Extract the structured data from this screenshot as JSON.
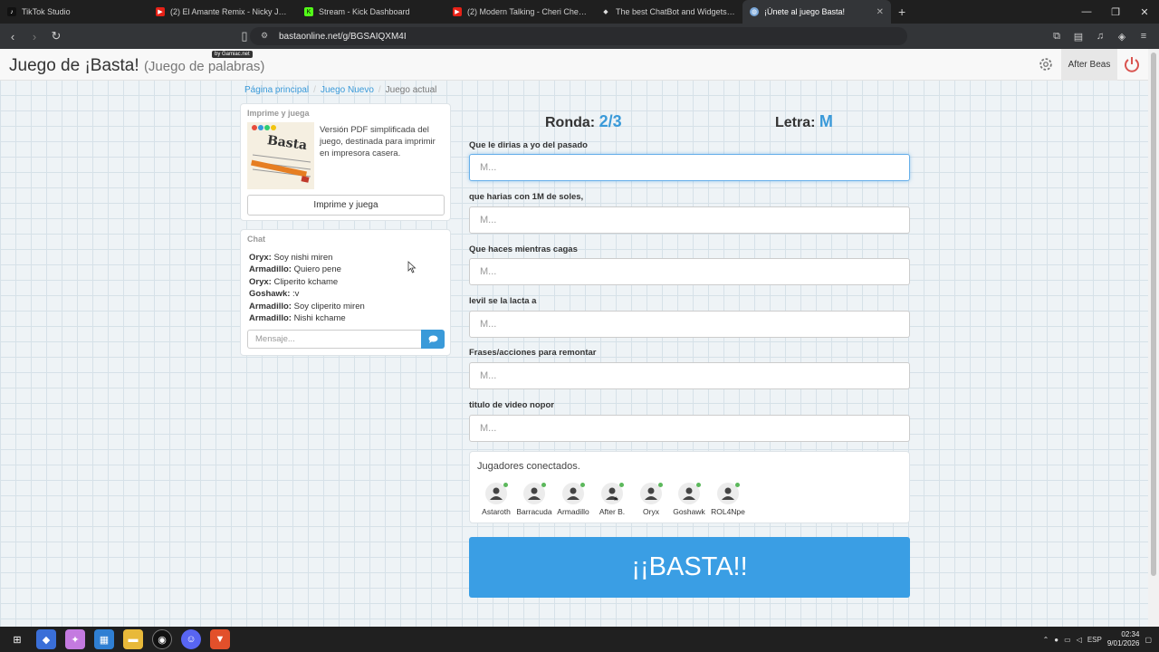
{
  "browser": {
    "tabs": [
      {
        "label": "TikTok Studio",
        "icon": "tiktok-icon",
        "color": "#111111"
      },
      {
        "label": "(2) El Amante Remix - Nicky Jam ft O",
        "icon": "youtube-icon",
        "color": "#e62117"
      },
      {
        "label": "Stream - Kick Dashboard",
        "icon": "kick-icon",
        "color": "#53fc18"
      },
      {
        "label": "(2) Modern Talking - Cheri Cheri Lady",
        "icon": "youtube-icon",
        "color": "#e62117"
      },
      {
        "label": "The best ChatBot and Widgets fo",
        "icon": "diamond-icon",
        "color": "#dddddd"
      },
      {
        "label": "¡Únete al juego Basta!",
        "icon": "globe-icon",
        "color": "#7aa7d9",
        "active": true
      }
    ],
    "url": "bastaonline.net/g/BGSAIQXM4I"
  },
  "navbar": {
    "title": "Juego de ¡Basta!",
    "subtitle": "(Juego de palabras)",
    "badge": "by Gamiac.net",
    "user": "After Beas",
    "accent": "#3a9ad9"
  },
  "breadcrumb": {
    "home": "Página principal",
    "new_game": "Juego Nuevo",
    "current": "Juego actual"
  },
  "print_panel": {
    "title": "Imprime y juega",
    "description": "Versión PDF simplificada del juego, destinada para imprimir en impresora casera.",
    "button": "Imprime y juega",
    "image_text": "Basta"
  },
  "chat": {
    "title": "Chat",
    "messages": [
      {
        "user": "Oryx:",
        "text": "Soy nishi miren"
      },
      {
        "user": "Armadillo:",
        "text": "Quiero pene"
      },
      {
        "user": "Oryx:",
        "text": "Cliperito kchame"
      },
      {
        "user": "Goshawk:",
        "text": ":v"
      },
      {
        "user": "Armadillo:",
        "text": "Soy cliperito miren"
      },
      {
        "user": "Armadillo:",
        "text": "Nishi kchame"
      }
    ],
    "placeholder": "Mensaje..."
  },
  "game": {
    "round_label": "Ronda:",
    "round_value": "2/3",
    "letter_label": "Letra:",
    "letter_value": "M",
    "categories": [
      {
        "label": "Que le dirias a yo del pasado",
        "placeholder": "M..."
      },
      {
        "label": "que harias con 1M de soles,",
        "placeholder": "M..."
      },
      {
        "label": "Que haces mientras cagas",
        "placeholder": "M..."
      },
      {
        "label": "levil se la lacta a",
        "placeholder": "M..."
      },
      {
        "label": "Frases/acciones para remontar",
        "placeholder": "M..."
      },
      {
        "label": "titulo de video nopor",
        "placeholder": "M..."
      }
    ],
    "players_title": "Jugadores conectados.",
    "players": [
      "Astaroth",
      "Barracuda",
      "Armadillo",
      "After B.",
      "Oryx",
      "Goshawk",
      "ROL4Npe"
    ],
    "basta_button": "¡¡BASTA!!",
    "basta_color": "#3a9ee4"
  },
  "taskbar": {
    "lang": "ESP",
    "time": "02:34",
    "date": "9/01/2026"
  }
}
